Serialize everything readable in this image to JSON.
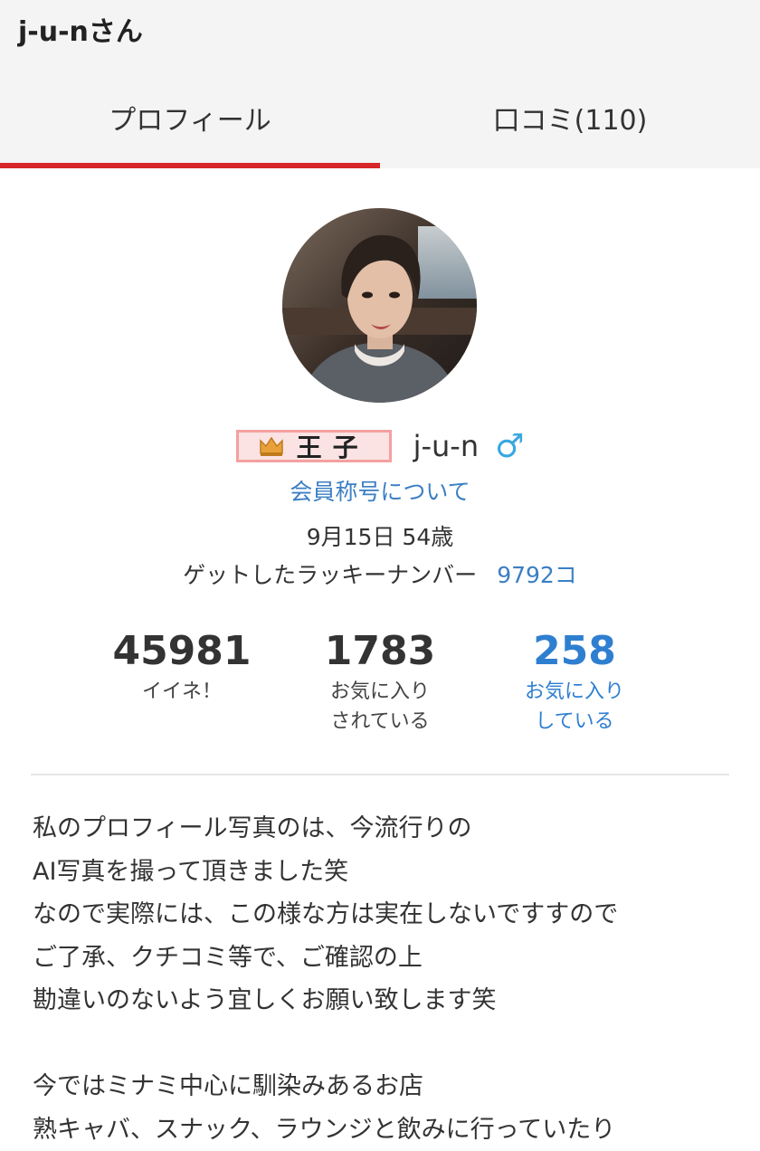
{
  "header": {
    "title": "j-u-nさん",
    "tabs": [
      {
        "label": "プロフィール",
        "active": true
      },
      {
        "label": "口コミ(110)",
        "active": false
      }
    ],
    "accent_color": "#d6262a"
  },
  "profile": {
    "avatar": "profile-photo",
    "rank_title": "王子",
    "rank_icon": "crown-icon",
    "name": "j-u-n",
    "gender_icon": "male-icon",
    "gender_symbol": "♂",
    "title_link": "会員称号について",
    "birthday_age": "9月15日 54歳",
    "lucky_label": "ゲットしたラッキーナンバー",
    "lucky_value": "9792コ"
  },
  "stats": [
    {
      "value": "45981",
      "label": "イイネ！"
    },
    {
      "value": "1783",
      "label": "お気に入り\nされている"
    },
    {
      "value": "258",
      "label": "お気に入り\nしている"
    }
  ],
  "bio": {
    "lines": [
      "私のプロフィール写真のは、今流行りの",
      "AI写真を撮って頂きました笑",
      "なので実際には、この様な方は実在しないですすので",
      "ご了承、クチコミ等で、ご確認の上",
      "勘違いのないよう宜しくお願い致します笑",
      "",
      "今ではミナミ中心に馴染みあるお店",
      "熟キャバ、スナック、ラウンジと飲みに行っていたり"
    ]
  }
}
